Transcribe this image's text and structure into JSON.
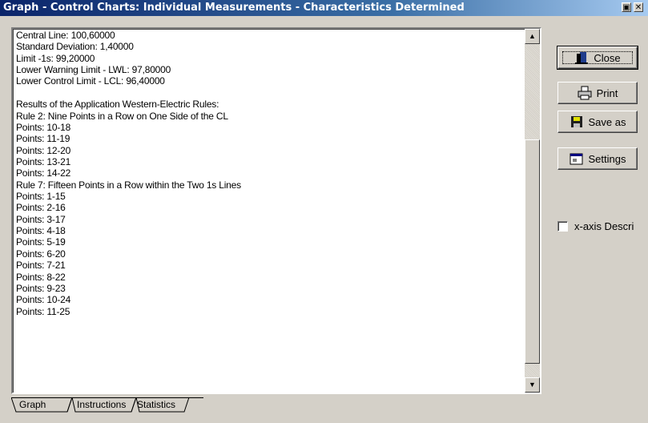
{
  "window": {
    "title": "Graph - Control Charts: Individual Measurements - Characteristics Determined"
  },
  "results": {
    "lines": [
      "Central Line: 100,60000",
      "Standard Deviation: 1,40000",
      "Limit -1s: 99,20000",
      "Lower Warning Limit - LWL: 97,80000",
      "Lower Control Limit - LCL: 96,40000",
      "",
      "Results of the Application Western-Electric Rules:",
      "Rule 2: Nine Points in a Row on One Side of the CL",
      "Points: 10-18",
      "Points: 11-19",
      "Points: 12-20",
      "Points: 13-21",
      "Points: 14-22",
      "Rule 7: Fifteen Points in a Row within the Two 1s Lines",
      "Points: 1-15",
      "Points: 2-16",
      "Points: 3-17",
      "Points: 4-18",
      "Points: 5-19",
      "Points: 6-20",
      "Points: 7-21",
      "Points: 8-22",
      "Points: 9-23",
      "Points: 10-24",
      "Points: 11-25"
    ]
  },
  "buttons": {
    "close": "Close",
    "print": "Print",
    "save_as": "Save as",
    "settings": "Settings"
  },
  "options": {
    "x_axis_label": "x-axis Descri",
    "x_axis_checked": false
  },
  "tabs": [
    "Graph",
    "Instructions",
    "Statistics"
  ],
  "active_tab": "Statistics",
  "icons": {
    "close": "door-exit-icon",
    "print": "printer-icon",
    "save_as": "floppy-disk-icon",
    "settings": "settings-dialog-icon"
  }
}
